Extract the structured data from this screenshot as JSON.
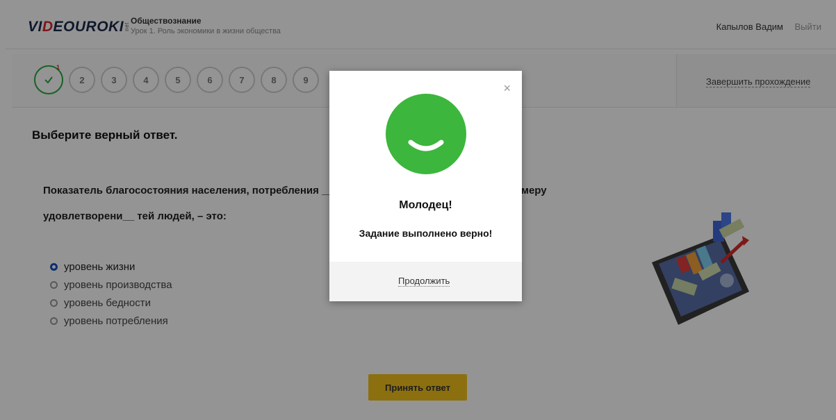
{
  "header": {
    "logo_vi": "VI",
    "logo_d": "D",
    "logo_rest": "EOUROKI",
    "logo_net": "net",
    "subject": "Обществознание",
    "lesson": "Урок 1. Роль экономики в жизни общества",
    "user_name": "Капылов Вадим",
    "logout_label": "Выйти"
  },
  "steps": {
    "items": [
      "1",
      "2",
      "3",
      "4",
      "5",
      "6",
      "7",
      "8",
      "9"
    ],
    "current_mark": "1",
    "finish_label": "Завершить прохождение"
  },
  "task": {
    "instruction": "Выберите верный ответ.",
    "question": "Показатель благосостояния населения, потребления __ й и показателей, характеризующих меру удовлетворени__ тей людей, – это:",
    "options": [
      "уровень жизни",
      "уровень производства",
      "уровень бедности",
      "уровень потребления"
    ],
    "selected_index": 0,
    "submit_label": "Принять ответ"
  },
  "modal": {
    "close_icon": "close-icon",
    "face_icon": "smiley-icon",
    "title": "Молодец!",
    "message": "Задание выполнено верно!",
    "continue_label": "Продолжить",
    "accent_color": "#3cb63c"
  },
  "colors": {
    "success": "#2aa842",
    "button": "#f1c21b",
    "radio_selected": "#1a4fbf"
  }
}
